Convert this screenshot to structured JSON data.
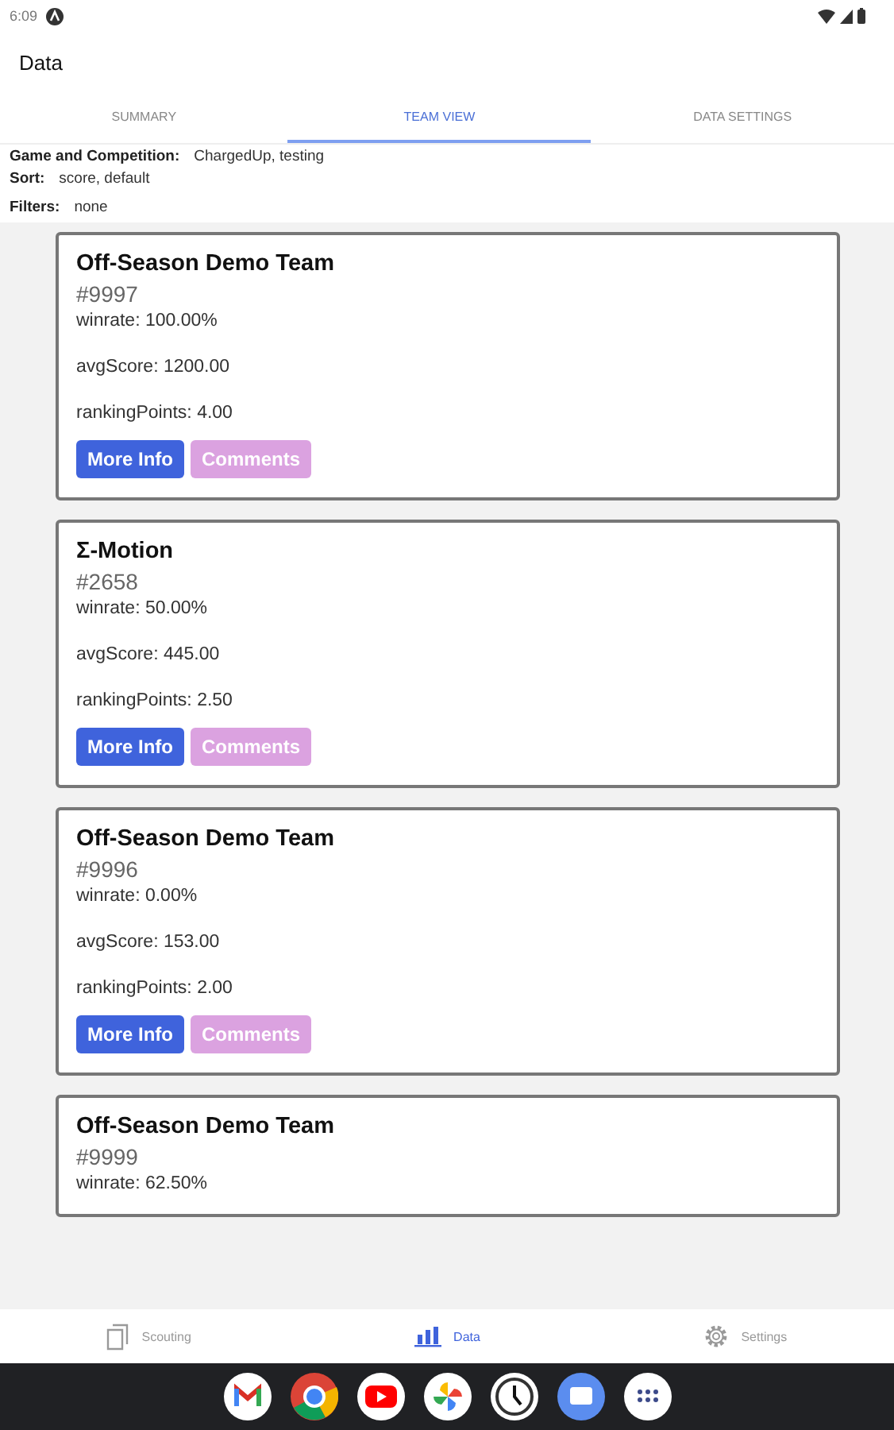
{
  "status_bar": {
    "time": "6:09"
  },
  "app_bar": {
    "title": "Data"
  },
  "tabs": [
    {
      "label": "SUMMARY",
      "selected": false
    },
    {
      "label": "TEAM VIEW",
      "selected": true
    },
    {
      "label": "DATA SETTINGS",
      "selected": false
    }
  ],
  "info": [
    {
      "label": "Game and Competition:",
      "value": "ChargedUp, testing"
    },
    {
      "label": "Sort:",
      "value": "score, default"
    },
    {
      "label": "Filters:",
      "value": "none"
    }
  ],
  "teams": [
    {
      "name": "Off-Season Demo Team",
      "number": "#9997",
      "stats": [
        "winrate: 100.00%",
        "avgScore: 1200.00",
        "rankingPoints: 4.00"
      ],
      "buttons": [
        "More Info",
        "Comments"
      ]
    },
    {
      "name": "Σ-Motion",
      "number": "#2658",
      "stats": [
        "winrate: 50.00%",
        "avgScore: 445.00",
        "rankingPoints: 2.50"
      ],
      "buttons": [
        "More Info",
        "Comments"
      ]
    },
    {
      "name": "Off-Season Demo Team",
      "number": "#9996",
      "stats": [
        "winrate: 0.00%",
        "avgScore: 153.00",
        "rankingPoints: 2.00"
      ],
      "buttons": [
        "More Info",
        "Comments"
      ]
    },
    {
      "name": "Off-Season Demo Team",
      "number": "#9999",
      "stats": [
        "winrate: 62.50%"
      ]
    }
  ],
  "bottom_nav": [
    {
      "kind": "scouting",
      "label": "Scouting",
      "selected": false
    },
    {
      "kind": "data",
      "label": "Data",
      "selected": true
    },
    {
      "kind": "settings",
      "label": "Settings",
      "selected": false
    }
  ]
}
